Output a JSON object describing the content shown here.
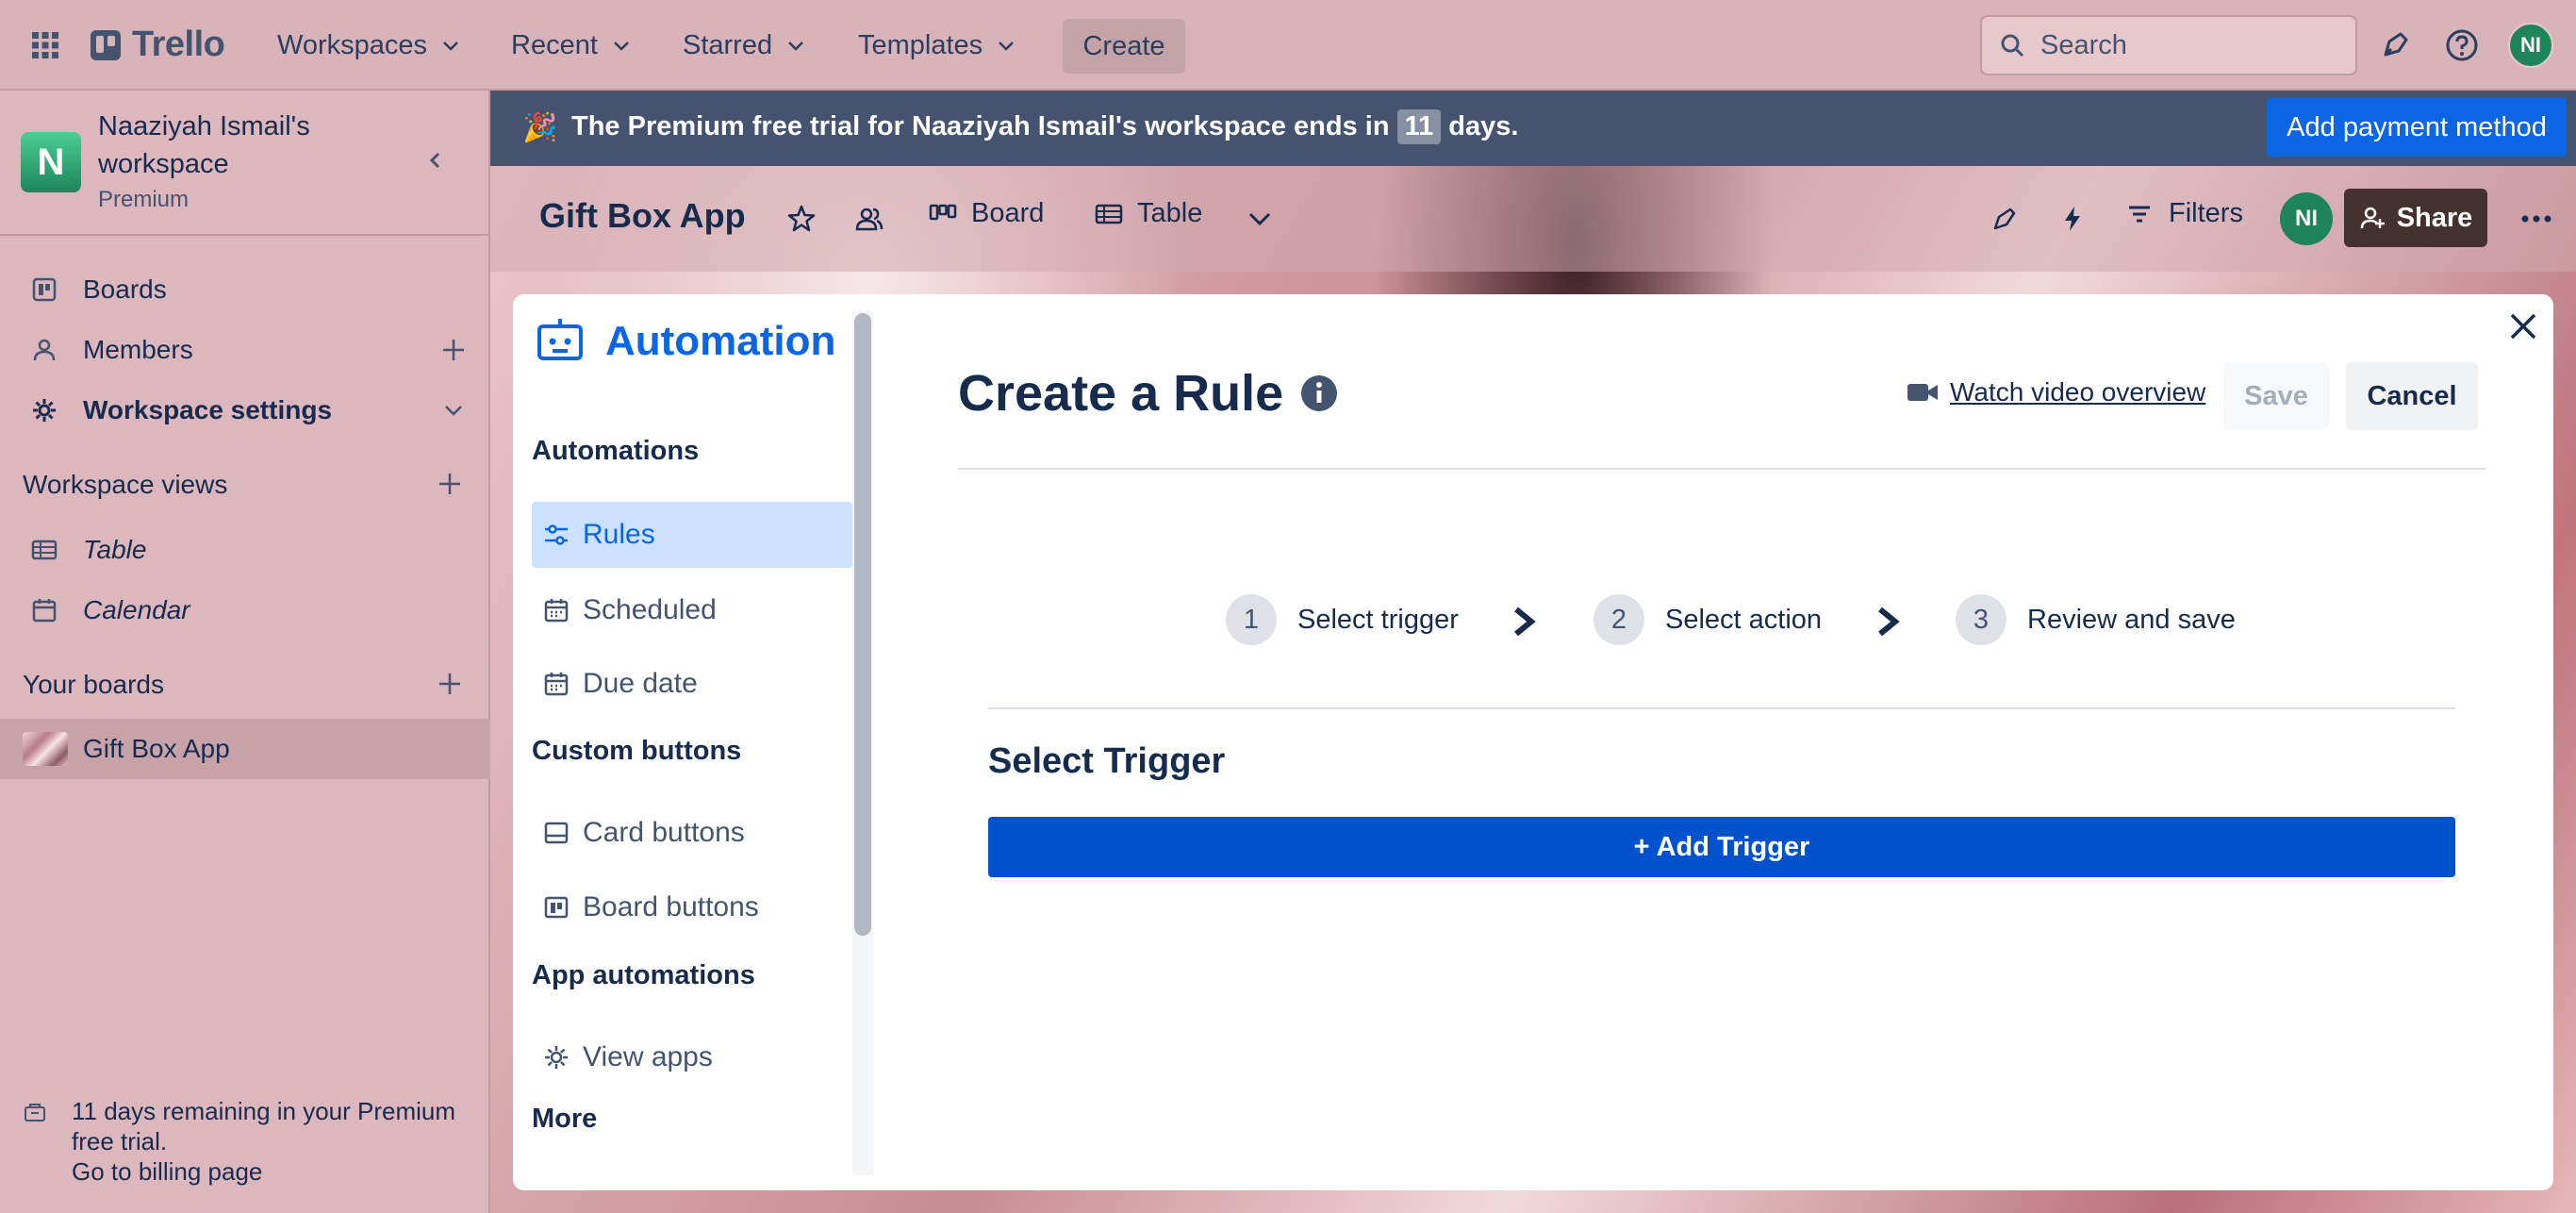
{
  "topnav": {
    "logo_text": "Trello",
    "menus": [
      {
        "label": "Workspaces"
      },
      {
        "label": "Recent"
      },
      {
        "label": "Starred"
      },
      {
        "label": "Templates"
      }
    ],
    "create_label": "Create",
    "search_placeholder": "Search",
    "avatar_initials": "NI"
  },
  "sidebar": {
    "workspace_initial": "N",
    "workspace_name": "Naaziyah Ismail's workspace",
    "workspace_plan": "Premium",
    "nav": [
      {
        "label": "Boards",
        "icon": "board-icon"
      },
      {
        "label": "Members",
        "icon": "person-icon"
      },
      {
        "label": "Workspace settings",
        "icon": "gear-icon"
      }
    ],
    "views_heading": "Workspace views",
    "views": [
      {
        "label": "Table",
        "icon": "table-icon"
      },
      {
        "label": "Calendar",
        "icon": "calendar-icon"
      }
    ],
    "boards_heading": "Your boards",
    "boards": [
      {
        "label": "Gift Box App"
      }
    ],
    "trial_note": "11 days remaining in your Premium free trial.",
    "billing_link": "Go to billing page"
  },
  "banner": {
    "emoji": "🎉",
    "text_before": "The Premium free trial for Naaziyah Ismail's workspace ends in",
    "days": "11",
    "text_after": "days.",
    "button_label": "Add payment method"
  },
  "board": {
    "title": "Gift Box App",
    "views": [
      {
        "label": "Board"
      },
      {
        "label": "Table"
      }
    ],
    "filters_label": "Filters",
    "avatar_initials": "NI",
    "share_label": "Share"
  },
  "automation": {
    "title": "Automation",
    "sections": [
      {
        "heading": "Automations",
        "items": [
          {
            "label": "Rules",
            "icon": "rules-icon",
            "active": true
          },
          {
            "label": "Scheduled",
            "icon": "calendar-icon"
          },
          {
            "label": "Due date",
            "icon": "calendar-icon"
          }
        ]
      },
      {
        "heading": "Custom buttons",
        "items": [
          {
            "label": "Card buttons",
            "icon": "card-icon"
          },
          {
            "label": "Board buttons",
            "icon": "board-icon"
          }
        ]
      },
      {
        "heading": "App automations",
        "items": [
          {
            "label": "View apps",
            "icon": "gear-icon"
          }
        ]
      },
      {
        "heading": "More",
        "items": []
      }
    ]
  },
  "rule": {
    "title": "Create a Rule",
    "video_link": "Watch video overview",
    "save_label": "Save",
    "cancel_label": "Cancel",
    "steps": [
      {
        "num": "1",
        "label": "Select trigger"
      },
      {
        "num": "2",
        "label": "Select action"
      },
      {
        "num": "3",
        "label": "Review and save"
      }
    ],
    "section_heading": "Select Trigger",
    "add_trigger_label": "+ Add Trigger"
  },
  "colors": {
    "brand_blue": "#0c66e4",
    "trigger_button": "#0052cc",
    "banner_bg": "#44546f",
    "avatar_green": "#1f845a"
  }
}
